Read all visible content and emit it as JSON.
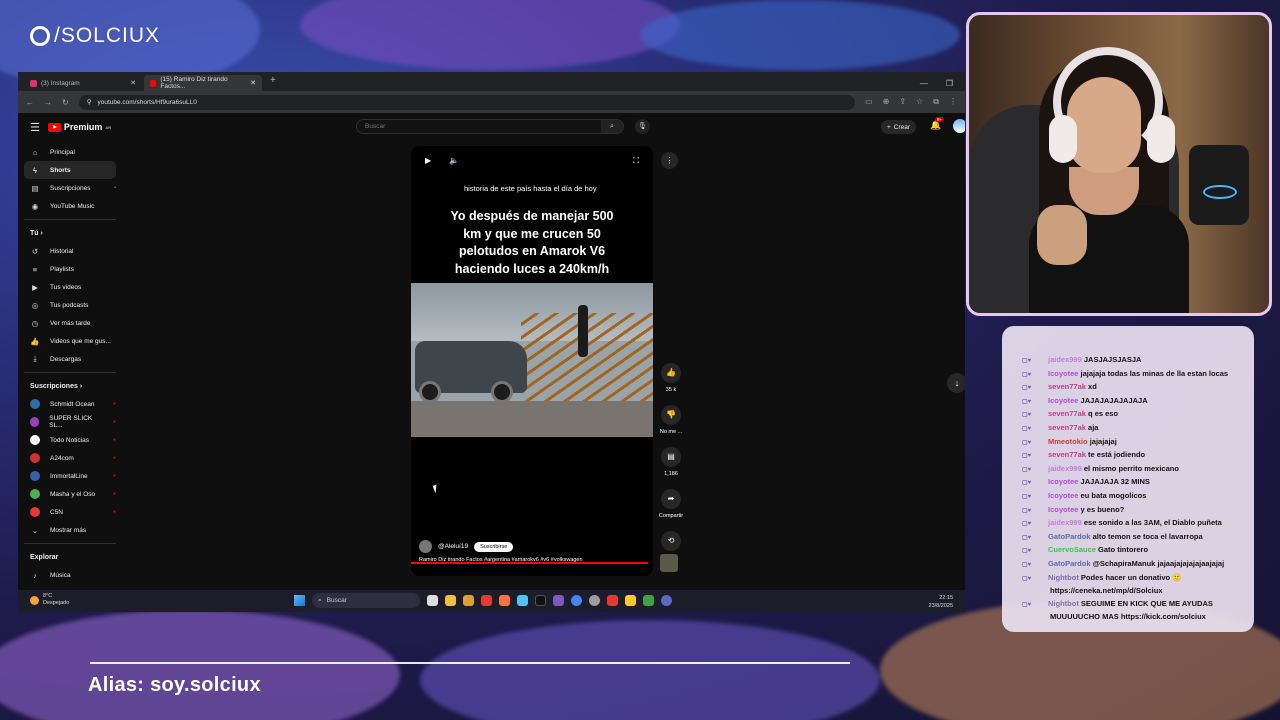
{
  "brand": {
    "handle": "/SOLCIUX"
  },
  "browser": {
    "tabs": [
      {
        "label": "(3) Instagram",
        "active": false,
        "icon_color": "#e1306c"
      },
      {
        "label": "(15) Ramiro Diz tirando Factos...",
        "active": true,
        "icon_color": "#ff0000"
      }
    ],
    "new_tab": "+",
    "url": "youtube.com/shorts/Hf9ura6suLL0"
  },
  "youtube": {
    "logo_text": "Premium",
    "logo_sup": "AR",
    "search_placeholder": "Buscar",
    "create_label": "Crear",
    "notif_badge": "9+",
    "sidebar_main": [
      {
        "label": "Principal",
        "icon": "home-icon"
      },
      {
        "label": "Shorts",
        "icon": "shorts-icon",
        "active": true
      },
      {
        "label": "Suscripciones",
        "icon": "subscriptions-icon",
        "dot": "•"
      },
      {
        "label": "YouTube Music",
        "icon": "music-icon"
      }
    ],
    "you_header": "Tú",
    "sidebar_you": [
      {
        "label": "Historial",
        "icon": "history-icon"
      },
      {
        "label": "Playlists",
        "icon": "playlist-icon"
      },
      {
        "label": "Tus videos",
        "icon": "video-icon"
      },
      {
        "label": "Tus podcasts",
        "icon": "podcast-icon"
      },
      {
        "label": "Ver más tarde",
        "icon": "clock-icon"
      },
      {
        "label": "Videos que me gus...",
        "icon": "like-icon"
      },
      {
        "label": "Descargas",
        "icon": "download-icon"
      }
    ],
    "subs_header": "Suscripciones",
    "subscriptions": [
      {
        "label": "Schmidt Ocean",
        "color": "#2e6fa7"
      },
      {
        "label": "SUPER SLICK SL...",
        "color": "#9a3fb5"
      },
      {
        "label": "Todo Noticias",
        "color": "#ffffff"
      },
      {
        "label": "A24com",
        "color": "#d32f2f"
      },
      {
        "label": "ImmortalLine",
        "color": "#3a5fa8"
      },
      {
        "label": "Masha y el Oso",
        "color": "#4caf50"
      },
      {
        "label": "C5N",
        "color": "#e53935"
      }
    ],
    "show_more": "Mostrar más",
    "explore_header": "Explorar",
    "explore_items": [
      {
        "label": "Música",
        "icon": "music-note-icon"
      }
    ]
  },
  "short": {
    "small_text": "historia de este país hasta el día de hoy",
    "caption_lines": [
      "Yo después de manejar 500",
      "km y que me crucen 50",
      "pelotudos en Amarok V6",
      "haciendo luces a 240km/h"
    ],
    "channel": "@Aleluí19",
    "subscribe": "Suscribirse",
    "description": "Ramiro Diz tirando Factos #argentina #amarokv6 #v6 #volkswagen",
    "likes": "35 k",
    "dislike_label": "No me ...",
    "comments": "1,186",
    "share_label": "Compartir",
    "remix_count": "1",
    "progress": 0.98
  },
  "taskbar": {
    "temp": "8°C",
    "weather": "Despejado",
    "search": "Buscar",
    "time": "22:15",
    "date": "23/8/2025"
  },
  "chat": [
    {
      "nick": "jaidex999",
      "color": "#c77dd6",
      "text": "JASJAJSJASJA"
    },
    {
      "nick": "Icoyotee",
      "color": "#b14bd8",
      "text": "jajajaja todas las minas de lla estan locas"
    },
    {
      "nick": "seven77ak",
      "color": "#c23b8a",
      "text": "xd"
    },
    {
      "nick": "Icoyotee",
      "color": "#b14bd8",
      "text": "JAJAJAJAJAJAJA"
    },
    {
      "nick": "seven77ak",
      "color": "#c23b8a",
      "text": "q es eso"
    },
    {
      "nick": "seven77ak",
      "color": "#c23b8a",
      "text": "aja"
    },
    {
      "nick": "Mmeotokio",
      "color": "#c83b3b",
      "text": "jajajajaj"
    },
    {
      "nick": "seven77ak",
      "color": "#c23b8a",
      "text": "te está jodiendo"
    },
    {
      "nick": "jaidex999",
      "color": "#c77dd6",
      "text": "el mismo perrito mexicano"
    },
    {
      "nick": "Icoyotee",
      "color": "#b14bd8",
      "text": "JAJAJAJA 32 MINS"
    },
    {
      "nick": "Icoyotee",
      "color": "#b14bd8",
      "text": "eu bata mogolicos"
    },
    {
      "nick": "Icoyotee",
      "color": "#b14bd8",
      "text": "y es bueno?"
    },
    {
      "nick": "jaidex999",
      "color": "#c77dd6",
      "text": "ese sonido a las 3AM, el Diablo puñeta"
    },
    {
      "nick": "GatoPardok",
      "color": "#5f6aa8",
      "text": "alto temon se toca el lavarropa"
    },
    {
      "nick": "CuervoSauce",
      "color": "#2ecc40",
      "text": "Gato tintorero"
    },
    {
      "nick": "GatoPardok",
      "color": "#5f6aa8",
      "text": "@SchapiraManuk jajaajajajajajaajajaj"
    },
    {
      "nick": "Nightbot",
      "color": "#7b6fa8",
      "text": "Podes hacer un donativo 🙂 https://ceneka.net/mp/d/Solciux"
    },
    {
      "nick": "Nightbot",
      "color": "#7b6fa8",
      "text": "SEGUIME EN KICK QUE ME AYUDAS MUUUUUCHO MAS https://kick.com/solciux"
    }
  ],
  "overlay": {
    "alias": "Alias: soy.solciux"
  }
}
